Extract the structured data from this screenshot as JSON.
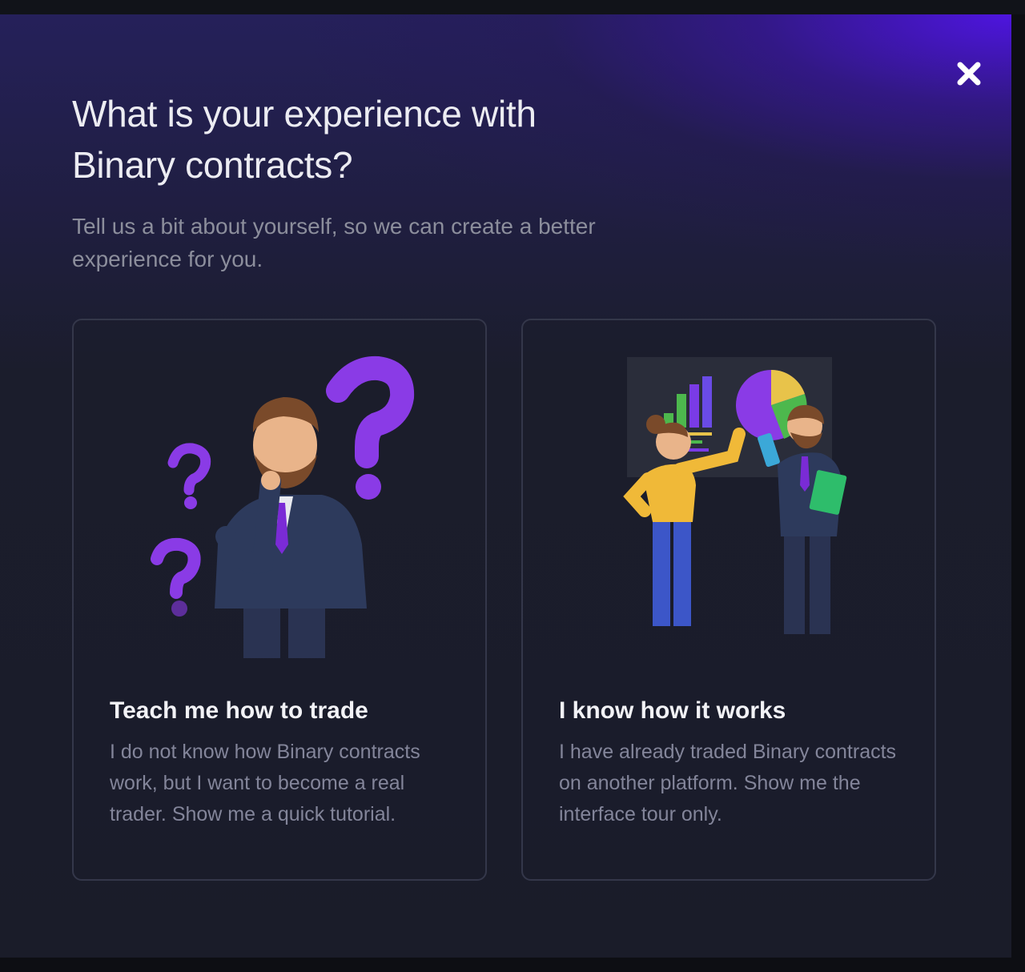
{
  "dialog": {
    "title_line1": "What is your experience with",
    "title_line2": "Binary contracts?",
    "subtitle_line1": "Tell us a bit about yourself, so we can create a better",
    "subtitle_line2": "experience for you.",
    "close_icon": "close-icon"
  },
  "options": [
    {
      "title": "Teach me how to trade",
      "description": "I do not know how Binary contracts work, but I want to become a real trader. Show me a quick tutorial.",
      "illustration": "confused-man-question-marks-illustration"
    },
    {
      "title": "I know how it works",
      "description": "I have already traded Binary contracts on another platform. Show me the interface tour only.",
      "illustration": "presentation-charts-illustration"
    }
  ],
  "colors": {
    "accent": "#5a1fe6",
    "question_mark": "#8a3be6",
    "card_border": "#34374a"
  }
}
